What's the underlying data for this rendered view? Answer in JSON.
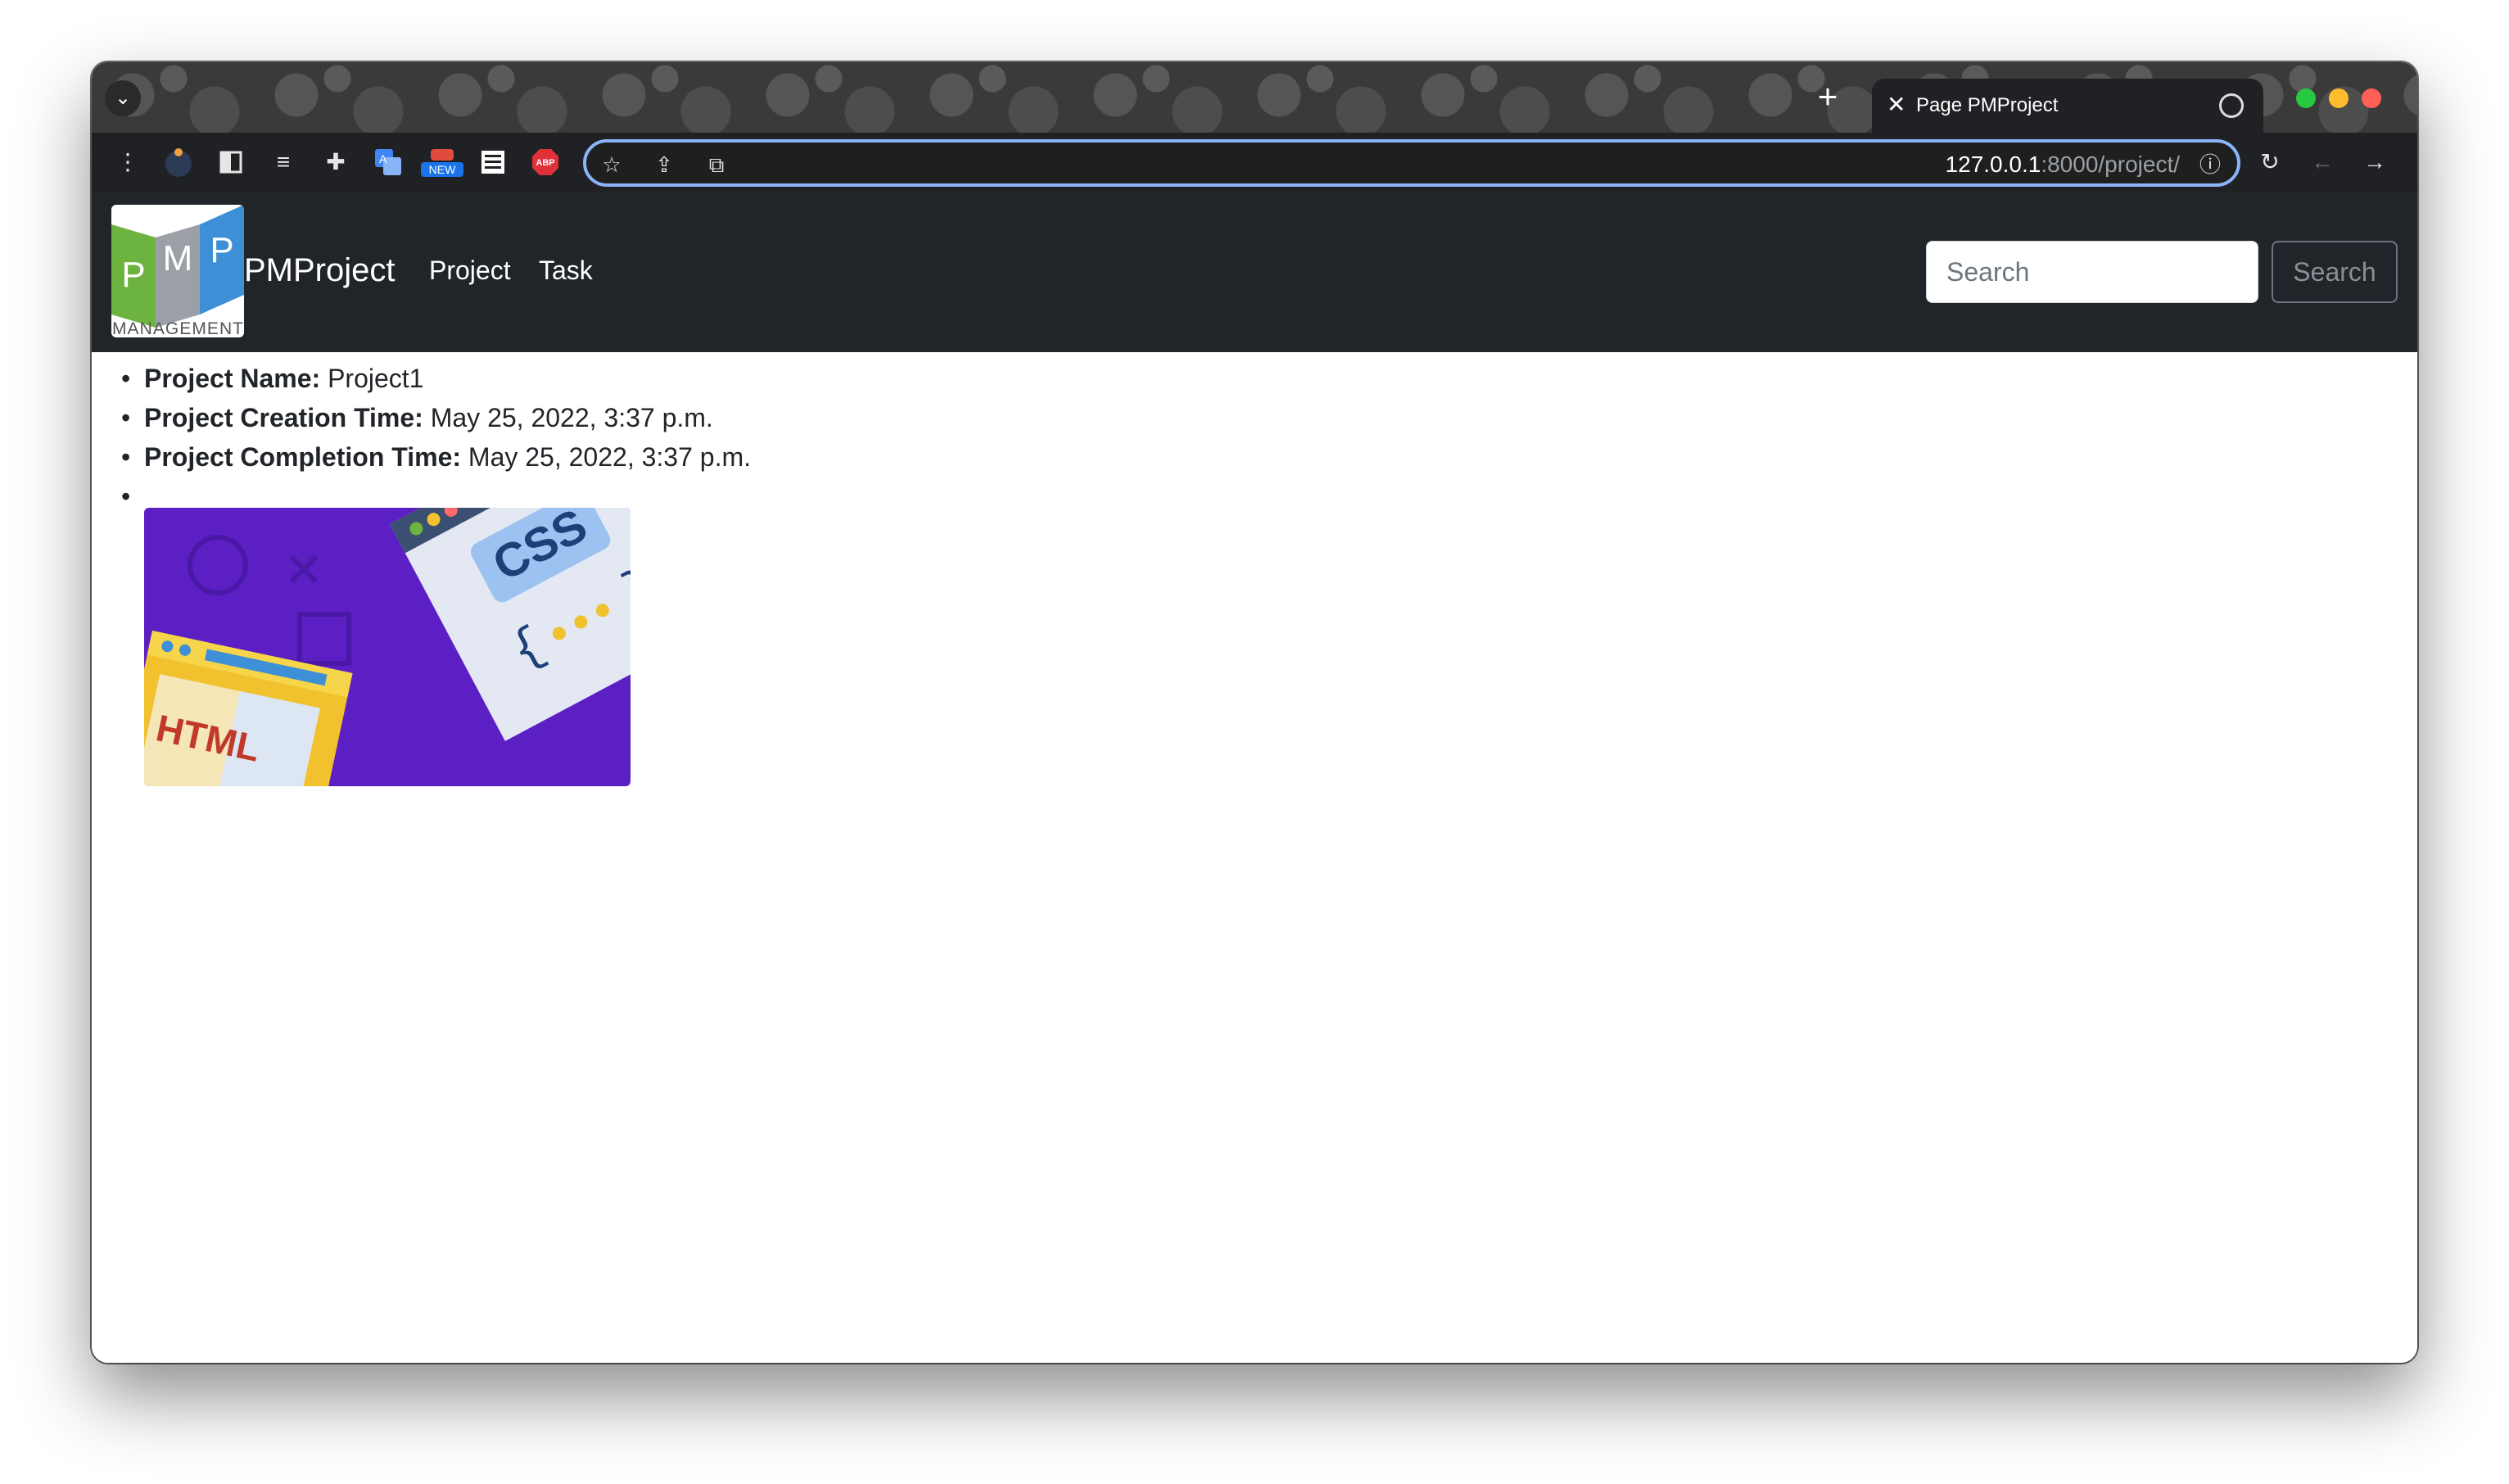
{
  "browser": {
    "tab_title": "Page PMProject",
    "tab_close_icon": "close-icon",
    "new_tab_icon": "plus-icon",
    "url_host": "127.0.0.1",
    "url_rest": ":8000/project/",
    "traffic_colors": [
      "#28c840",
      "#febc2e",
      "#ff5f57"
    ],
    "extension_badge": "NEW",
    "abp_label": "ABP"
  },
  "navbar": {
    "logo_letters": [
      "P",
      "M",
      "P"
    ],
    "logo_caption": "MANAGEMENT",
    "brand": "PMProject",
    "links": [
      "Project",
      "Task"
    ],
    "search_placeholder": "Search",
    "search_button": "Search"
  },
  "project": {
    "name_label": "Project Name:",
    "name_value": "Project1",
    "creation_label": "Project Creation Time:",
    "creation_value": "May 25, 2022, 3:37 p.m.",
    "completion_label": "Project Completion Time:",
    "completion_value": "May 25, 2022, 3:37 p.m.",
    "image_texts": [
      "HTML",
      "CSS"
    ]
  },
  "colors": {
    "navbar_bg": "#212529",
    "omnibox_border": "#8ab4f8",
    "image_bg": "#5b1fc4"
  }
}
